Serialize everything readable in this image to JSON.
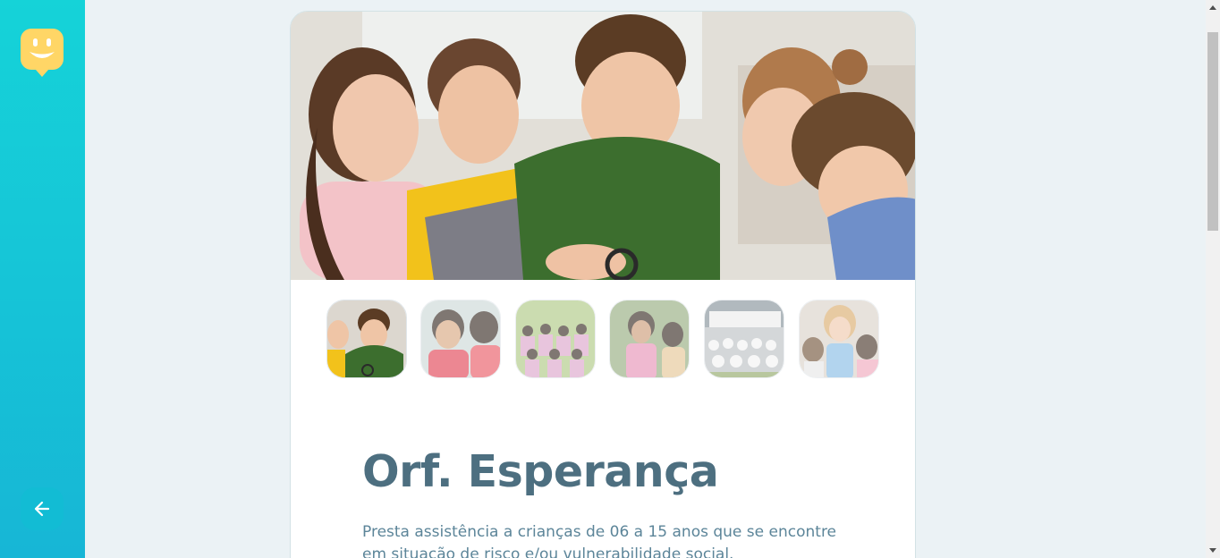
{
  "sidebar": {
    "logo_icon": "smiley-chat-icon",
    "back_icon": "arrow-left-icon",
    "colors": {
      "gradient_top": "#15d3d8",
      "gradient_bottom": "#17b6d6",
      "logo": "#ffd666",
      "back_button": "#12bcd4"
    }
  },
  "orphanage": {
    "name": "Orf. Esperança",
    "about": "Presta assistência a crianças de 06 a 15 anos que se encontre em situação de risco e/ou vulnerabilidade social.",
    "hero_image": "children-looking-through-magnifying-glass",
    "thumbnails": [
      {
        "subject": "children-with-magnifying-glass",
        "active": true
      },
      {
        "subject": "two-children-red-shirts",
        "active": false
      },
      {
        "subject": "group-of-girls-pink-shirts",
        "active": false
      },
      {
        "subject": "two-small-children",
        "active": false
      },
      {
        "subject": "large-group-outside-building",
        "active": false
      },
      {
        "subject": "woman-with-children",
        "active": false
      }
    ]
  },
  "colors": {
    "title": "#4d6f80",
    "text": "#5c8599",
    "background": "#ebf2f5"
  }
}
